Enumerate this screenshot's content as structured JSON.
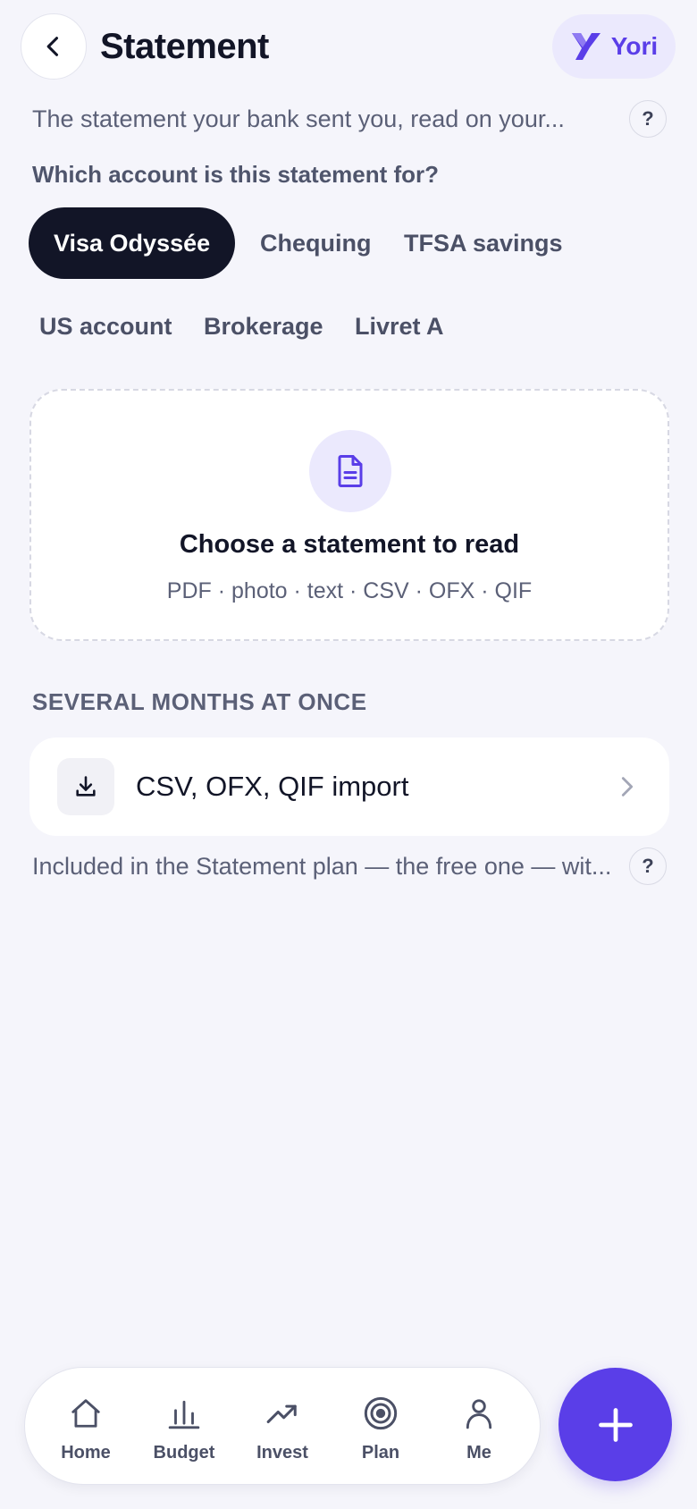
{
  "header": {
    "title": "Statement",
    "brand_name": "Yori"
  },
  "intro": {
    "text": "The statement your bank sent you, read on your...",
    "help": "?"
  },
  "accounts": {
    "question": "Which account is this statement for?",
    "options": [
      "Visa Odyssée",
      "Chequing",
      "TFSA savings",
      "US account",
      "Brokerage",
      "Livret A"
    ],
    "selected": "Visa Odyssée"
  },
  "upload": {
    "title": "Choose a statement to read",
    "formats": "PDF · photo · text · CSV · OFX · QIF"
  },
  "bulk": {
    "section_label": "SEVERAL MONTHS AT ONCE",
    "import_label": "CSV, OFX, QIF import",
    "note": "Included in the Statement plan — the free one — wit...",
    "help": "?"
  },
  "nav": {
    "items": [
      {
        "label": "Home",
        "icon": "home-icon"
      },
      {
        "label": "Budget",
        "icon": "bar-chart-icon"
      },
      {
        "label": "Invest",
        "icon": "trend-up-icon"
      },
      {
        "label": "Plan",
        "icon": "target-icon"
      },
      {
        "label": "Me",
        "icon": "person-icon"
      }
    ]
  },
  "colors": {
    "accent": "#5a3ee8",
    "accent_soft": "#ebe9fd",
    "dark": "#121527",
    "background": "#f5f5fb"
  }
}
